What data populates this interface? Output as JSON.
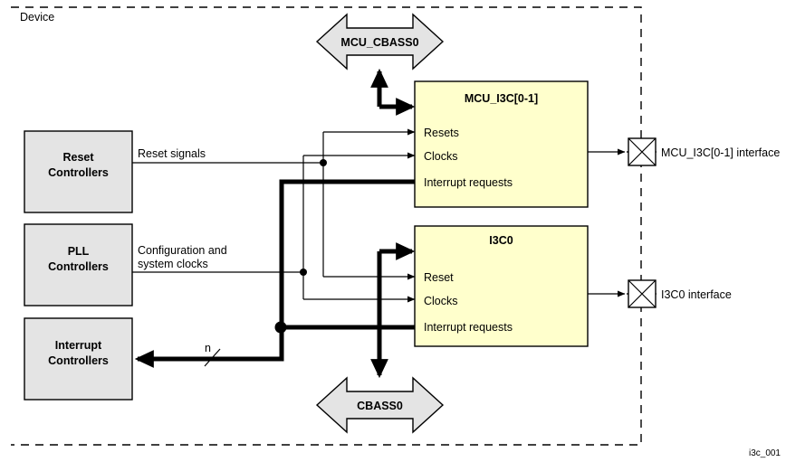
{
  "figure": {
    "device_label": "Device",
    "tag": "i3c_001"
  },
  "controllers": [
    {
      "id": "reset-controllers",
      "line1": "Reset",
      "line2": "Controllers"
    },
    {
      "id": "pll-controllers",
      "line1": "PLL",
      "line2": "Controllers"
    },
    {
      "id": "interrupt-controllers",
      "line1": "Interrupt",
      "line2": "Controllers"
    }
  ],
  "signal_labels": {
    "reset_signals": "Reset signals",
    "config_clocks_line1": "Configuration and",
    "config_clocks_line2": "system clocks",
    "bus_width": "n"
  },
  "buses": [
    {
      "id": "mcu-cbass0",
      "label": "MCU_CBASS0"
    },
    {
      "id": "cbass0",
      "label": "CBASS0"
    }
  ],
  "modules": [
    {
      "id": "mcu-i3c",
      "title": "MCU_I3C[0-1]",
      "ports": [
        "Resets",
        "Clocks",
        "Interrupt requests"
      ]
    },
    {
      "id": "i3c0",
      "title": "I3C0",
      "ports": [
        "Reset",
        "Clocks",
        "Interrupt requests"
      ]
    }
  ],
  "interfaces": [
    {
      "id": "mcu-i3c-interface",
      "label": "MCU_I3C[0-1] interface"
    },
    {
      "id": "i3c0-interface",
      "label": "I3C0 interface"
    }
  ],
  "colors": {
    "module_fill": "#ffffcc",
    "controller_fill": "#e4e4e4",
    "bus_fill": "#e4e4e4",
    "stroke": "#000000",
    "background": "#ffffff"
  }
}
